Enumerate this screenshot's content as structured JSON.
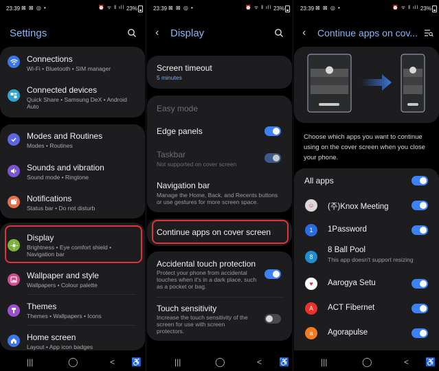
{
  "status": {
    "time": "23:39",
    "left_icons": "⊠ ⊠ ◎ •",
    "right_icons": "⏰ ᯤ ‖ ıll",
    "battery": "23%"
  },
  "settings": {
    "title": "Settings",
    "items": [
      {
        "label": "Connections",
        "sub": "Wi-Fi  •  Bluetooth  •  SIM manager",
        "color": "#3a76e6"
      },
      {
        "label": "Connected devices",
        "sub": "Quick Share  •  Samsung DeX  •  Android Auto",
        "color": "#2fa6c9"
      },
      {
        "label": "Modes and Routines",
        "sub": "Modes  •  Routines",
        "color": "#5b66df"
      },
      {
        "label": "Sounds and vibration",
        "sub": "Sound mode  •  Ringtone",
        "color": "#7a55d6"
      },
      {
        "label": "Notifications",
        "sub": "Status bar  •  Do not disturb",
        "color": "#e66d47"
      },
      {
        "label": "Display",
        "sub": "Brightness  •  Eye comfort shield  •  Navigation bar",
        "color": "#7bb33a"
      },
      {
        "label": "Wallpaper and style",
        "sub": "Wallpapers  •  Colour palette",
        "color": "#cf4d8e"
      },
      {
        "label": "Themes",
        "sub": "Themes  •  Wallpapers  •  Icons",
        "color": "#9b4fd0"
      },
      {
        "label": "Home screen",
        "sub": "Layout  •  App icon badges",
        "color": "#3a76e6"
      }
    ]
  },
  "display": {
    "title": "Display",
    "screen_timeout": {
      "label": "Screen timeout",
      "value": "5 minutes"
    },
    "easy_mode": "Easy mode",
    "edge_panels": "Edge panels",
    "taskbar": {
      "label": "Taskbar",
      "sub": "Not supported on cover screen"
    },
    "navigation_bar": {
      "label": "Navigation bar",
      "sub": "Manage the Home, Back, and Recents buttons or use gestures for more screen space."
    },
    "continue_apps": "Continue apps on cover screen",
    "accidental_touch": {
      "label": "Accidental touch protection",
      "sub": "Protect your phone from accidental touches when it's in a dark place, such as a pocket or bag."
    },
    "touch_sensitivity": {
      "label": "Touch sensitivity",
      "sub": "Increase the touch sensitivity of the screen for use with screen protectors."
    }
  },
  "continue": {
    "title": "Continue apps on cov...",
    "description": "Choose which apps you want to continue using on the cover screen when you close your phone.",
    "all_apps": "All apps",
    "apps": [
      {
        "name": "(주)Knox Meeting",
        "sub": "",
        "color": "#d9d9d9",
        "glyph": "☺",
        "on": true
      },
      {
        "name": "1Password",
        "sub": "",
        "color": "#2b6de0",
        "glyph": "1",
        "on": true
      },
      {
        "name": "8 Ball Pool",
        "sub": "This app doesn't support resizing",
        "color": "#1f8fd1",
        "glyph": "8",
        "on": false
      },
      {
        "name": "Aarogya Setu",
        "sub": "",
        "color": "#ffffff",
        "glyph": "♥",
        "on": true
      },
      {
        "name": "ACT Fibernet",
        "sub": "",
        "color": "#e8322b",
        "glyph": "A",
        "on": true
      },
      {
        "name": "Agorapulse",
        "sub": "",
        "color": "#f47c20",
        "glyph": "a",
        "on": true
      }
    ]
  },
  "nav": {
    "recents": "|||",
    "home": "◯",
    "back": "<",
    "accessibility": "♿"
  }
}
